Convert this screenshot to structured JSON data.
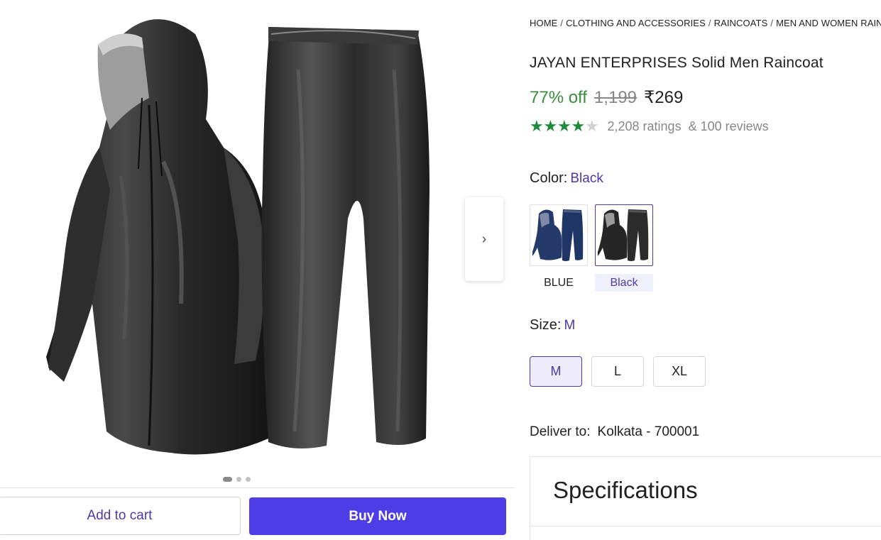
{
  "breadcrumb": [
    "HOME",
    "CLOTHING AND ACCESSORIES",
    "RAINCOATS",
    "MEN AND WOMEN RAINCOATS"
  ],
  "product": {
    "title": "JAYAN ENTERPRISES Solid Men Raincoat",
    "discount": "77% off",
    "mrp": "1,199",
    "price": "₹269",
    "rating_stars": 4,
    "rating_max": 5,
    "ratings_text": "2,208 ratings",
    "reviews_text": "& 100 reviews"
  },
  "color": {
    "label": "Color:",
    "selected": "Black",
    "options": [
      {
        "label": "BLUE",
        "selected": false
      },
      {
        "label": "Black",
        "selected": true
      }
    ]
  },
  "size": {
    "label": "Size:",
    "selected": "M",
    "options": [
      {
        "label": "M",
        "selected": true
      },
      {
        "label": "L",
        "selected": false
      },
      {
        "label": "XL",
        "selected": false
      }
    ]
  },
  "delivery": {
    "label": "Deliver to:",
    "location": "Kolkata - 700001"
  },
  "specifications": {
    "title": "Specifications"
  },
  "gallery": {
    "next_icon": "chevron-right-icon",
    "dot_count": 3,
    "active_dot": 0
  },
  "actions": {
    "add_to_cart": "Add to cart",
    "buy_now": "Buy Now"
  },
  "colors": {
    "accent": "#4a3aa8",
    "buy_button": "#4e3de7",
    "discount": "#388e3c",
    "star": "#1e8b3a"
  }
}
